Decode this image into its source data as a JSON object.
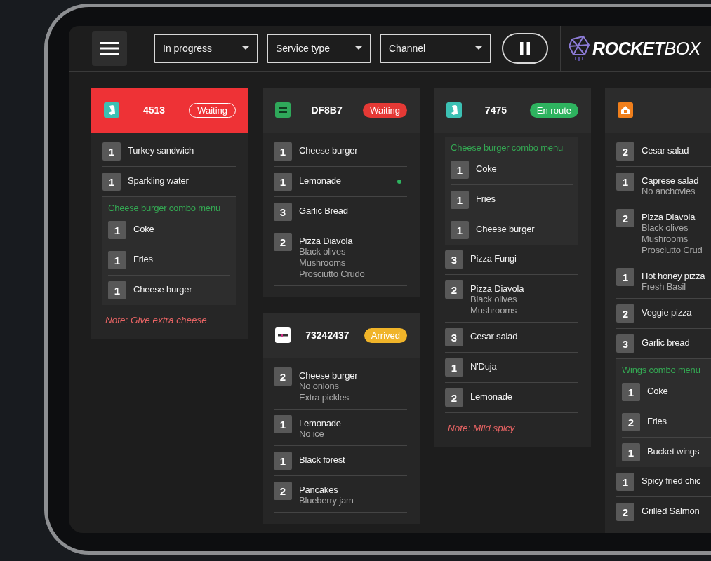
{
  "toolbar": {
    "filters": [
      {
        "label": "In progress"
      },
      {
        "label": "Service type"
      },
      {
        "label": "Channel"
      }
    ],
    "pause": {
      "paused": false
    },
    "logo": {
      "text": "**ROCKET**BOX"
    }
  },
  "columns": [
    [
      {
        "app": {
          "kind": "kangaroo"
        },
        "number": "4513",
        "urgent": true,
        "status": {
          "label": "Waiting",
          "color": "#e53935"
        },
        "items": [
          {
            "kind": "item",
            "qty": "1",
            "name": "Turkey sandwich",
            "ready": false
          },
          {
            "kind": "item",
            "qty": "1",
            "name": "Sparkling water",
            "ready": false
          },
          {
            "kind": "combo",
            "title": "Cheese burger combo menu",
            "items": [
              {
                "qty": "1",
                "name": "Coke",
                "ready": false
              },
              {
                "qty": "1",
                "name": "Fries",
                "ready": false
              },
              {
                "qty": "1",
                "name": "Cheese burger",
                "ready": false
              }
            ]
          }
        ],
        "note": "Note: Give extra cheese"
      }
    ],
    [
      {
        "app": {
          "kind": "green"
        },
        "number": "DF8B7",
        "urgent": false,
        "status": {
          "label": "Waiting",
          "color": "#e53935"
        },
        "items": [
          {
            "kind": "item",
            "qty": "1",
            "name": "Cheese burger",
            "ready": false
          },
          {
            "kind": "item",
            "qty": "1",
            "name": "Lemonade",
            "ready": true
          },
          {
            "kind": "item",
            "qty": "3",
            "name": "Garlic Bread",
            "ready": false
          },
          {
            "kind": "item",
            "qty": "2",
            "name": "Pizza Diavola",
            "notes": [
              "Black olives",
              "Mushrooms",
              "Prosciutto Crudo"
            ],
            "ready": false
          }
        ]
      },
      {
        "app": {
          "kind": "white"
        },
        "number": "73242437",
        "urgent": false,
        "status": {
          "label": "Arrived",
          "color": "#f0b429"
        },
        "items": [
          {
            "kind": "item",
            "qty": "2",
            "name": "Cheese burger",
            "notes": [
              "No onions",
              "Extra pickles"
            ],
            "ready": false
          },
          {
            "kind": "item",
            "qty": "1",
            "name": "Lemonade",
            "notes": [
              "No ice"
            ],
            "ready": false
          },
          {
            "kind": "item",
            "qty": "1",
            "name": "Black forest",
            "ready": false
          },
          {
            "kind": "item",
            "qty": "2",
            "name": "Pancakes",
            "notes": [
              "Blueberry jam"
            ],
            "ready": false
          }
        ]
      }
    ],
    [
      {
        "app": {
          "kind": "kangaroo"
        },
        "number": "7475",
        "urgent": false,
        "status": {
          "label": "En route",
          "color": "#2eb35f"
        },
        "items": [
          {
            "kind": "combo",
            "title": "Cheese burger combo menu",
            "items": [
              {
                "qty": "1",
                "name": "Coke",
                "ready": false
              },
              {
                "qty": "1",
                "name": "Fries",
                "ready": false
              },
              {
                "qty": "1",
                "name": "Cheese burger",
                "ready": false
              }
            ]
          },
          {
            "kind": "item",
            "qty": "3",
            "name": "Pizza Fungi",
            "ready": false
          },
          {
            "kind": "item",
            "qty": "2",
            "name": "Pizza Diavola",
            "notes": [
              "Black olives",
              "Mushrooms"
            ],
            "ready": false
          },
          {
            "kind": "item",
            "qty": "3",
            "name": "Cesar salad",
            "ready": false
          },
          {
            "kind": "item",
            "qty": "1",
            "name": "N'Duja",
            "ready": false
          },
          {
            "kind": "item",
            "qty": "2",
            "name": "Lemonade",
            "ready": false
          }
        ],
        "note": "Note: Mild spicy"
      }
    ],
    [
      {
        "app": {
          "kind": "house"
        },
        "urgent": false,
        "items": [
          {
            "kind": "item",
            "qty": "2",
            "name": "Cesar salad"
          },
          {
            "kind": "item",
            "qty": "1",
            "name": "Caprese salad",
            "notes": [
              "No anchovies"
            ]
          },
          {
            "kind": "item",
            "qty": "2",
            "name": "Pizza Diavola",
            "notes": [
              "Black olives",
              "Mushrooms",
              "Prosciutto Crud"
            ]
          },
          {
            "kind": "item",
            "qty": "1",
            "name": "Hot honey pizza",
            "notes": [
              "Fresh Basil"
            ]
          },
          {
            "kind": "item",
            "qty": "2",
            "name": "Veggie pizza"
          },
          {
            "kind": "item",
            "qty": "3",
            "name": "Garlic bread"
          },
          {
            "kind": "combo",
            "title": "Wings combo menu",
            "items": [
              {
                "qty": "1",
                "name": "Coke"
              },
              {
                "qty": "2",
                "name": "Fries"
              },
              {
                "qty": "1",
                "name": "Bucket wings"
              }
            ]
          },
          {
            "kind": "item",
            "qty": "1",
            "name": "Spicy fried chic"
          },
          {
            "kind": "item",
            "qty": "2",
            "name": "Grilled Salmon"
          }
        ]
      }
    ]
  ]
}
